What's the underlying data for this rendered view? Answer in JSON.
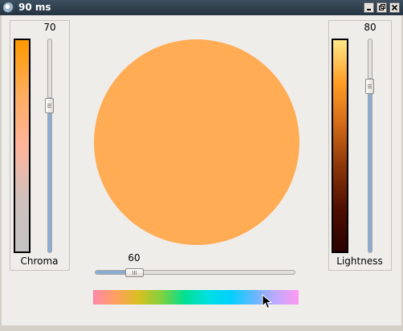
{
  "window": {
    "title": "90 ms",
    "buttons": [
      "minimize-icon",
      "maximize-icon",
      "close-icon"
    ]
  },
  "chroma": {
    "label": "Chroma",
    "value_label": "70",
    "value": 70,
    "max": 100,
    "gradient": [
      "#ff9900",
      "#ffac5c",
      "#ffb49a",
      "#cfc0bd",
      "#c4c4c4"
    ]
  },
  "lightness": {
    "label": "Lightness",
    "value_label": "80",
    "value": 80,
    "max": 100,
    "gradient": [
      "#ffe889",
      "#ff9e25",
      "#d26b17",
      "#8b3508",
      "#4e0f02",
      "#2b0000"
    ]
  },
  "hue": {
    "value_label": "60",
    "value": 60,
    "max": 360,
    "gradient": [
      "#ff88aa",
      "#ffa060",
      "#d8c020",
      "#80d040",
      "#00e090",
      "#00e0e0",
      "#00d0ff",
      "#60b8ff",
      "#c0a8ff",
      "#ff98f0"
    ]
  },
  "preview": {
    "color": "#ffac55",
    "shape": "circle"
  },
  "cursor": {
    "icon": "arrow-cursor-icon"
  }
}
